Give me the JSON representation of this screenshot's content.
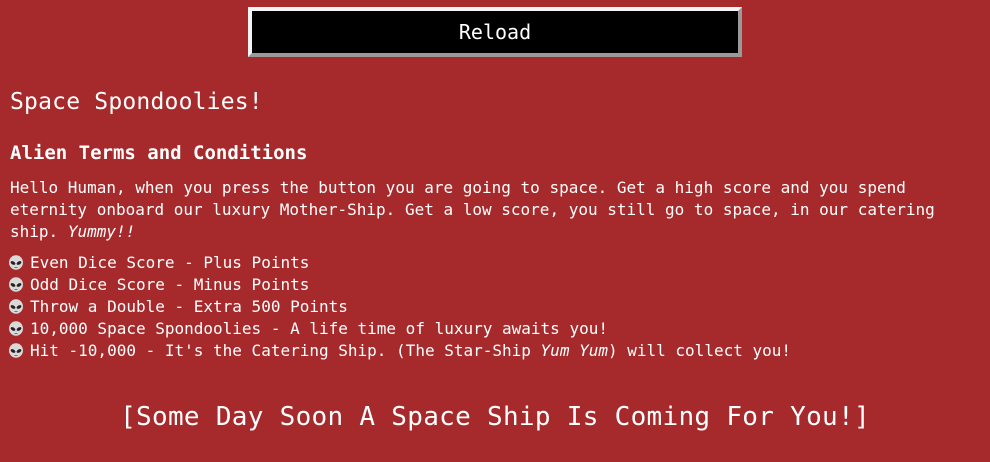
{
  "reload_button": {
    "label": "Reload"
  },
  "title": "Space Spondoolies!",
  "terms": {
    "heading": "Alien Terms and Conditions",
    "intro_text": "Hello Human, when you press the button you are going to space. Get a high score and you spend eternity onboard our luxury Mother-Ship. Get a low score, you still go to space, in our catering ship.",
    "intro_emphasis": "Yummy!!"
  },
  "rules": [
    {
      "text": "Even Dice Score - Plus Points"
    },
    {
      "text": "Odd Dice Score - Minus Points"
    },
    {
      "text": "Throw a Double - Extra 500 Points"
    },
    {
      "text": "10,000 Space Spondoolies - A life time of luxury awaits you!"
    },
    {
      "text_before": "Hit -10,000 - It's the Catering Ship. (The Star-Ship ",
      "emphasis": "Yum Yum",
      "text_after": ") will collect you!"
    }
  ],
  "rule_icon": "alien-icon",
  "footer_message": "[Some Day Soon A Space Ship Is Coming For You!]",
  "colors": {
    "background": "#a6292b",
    "button_background": "#000000",
    "text": "#ffffff"
  }
}
